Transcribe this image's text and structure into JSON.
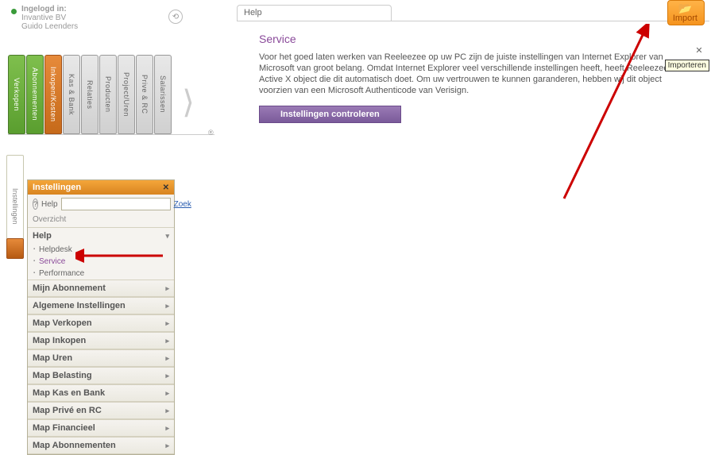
{
  "header": {
    "login_label": "Ingelogd in:",
    "company": "Invantive BV",
    "user": "Guido  Leenders"
  },
  "binders": [
    {
      "label": "Verkopen",
      "color": "green"
    },
    {
      "label": "Abonnementen",
      "color": "green"
    },
    {
      "label": "Inkopen/Kosten",
      "color": "orange"
    },
    {
      "label": "Kas & Bank",
      "color": "gray"
    },
    {
      "label": "Relaties",
      "color": "gray"
    },
    {
      "label": "Producten",
      "color": "gray"
    },
    {
      "label": "Project/Uren",
      "color": "gray"
    },
    {
      "label": "Prive & RC",
      "color": "gray"
    },
    {
      "label": "Salarissen",
      "color": "gray"
    }
  ],
  "settings_tab_label": "Instellingen",
  "panel": {
    "title": "Instellingen",
    "help_label": "Help",
    "search_placeholder": "",
    "zoek": "Zoek",
    "overzicht": "Overzicht",
    "help_group": "Help",
    "help_items": [
      "Helpdesk",
      "Service",
      "Performance"
    ],
    "groups": [
      "Mijn Abonnement",
      "Algemene Instellingen",
      "Map Verkopen",
      "Map Inkopen",
      "Map Uren",
      "Map Belasting",
      "Map Kas en Bank",
      "Map Privé en RC",
      "Map Financieel",
      "Map Abonnementen"
    ]
  },
  "main": {
    "breadcrumb": "Help",
    "import_label": "Import",
    "import_tooltip": "Importeren",
    "title": "Service",
    "body": "Voor het goed laten werken van Reeleezee op uw PC zijn de juiste instellingen van Internet Explorer van Microsoft van groot belang. Omdat Internet Explorer veel verschillende instellingen heeft, heeft Reeleezee een Active X object die dit automatisch doet. Om uw vertrouwen te kunnen garanderen, hebben wij dit object voorzien van een Microsoft Authenticode van Verisign.",
    "check_btn": "Instellingen controleren"
  }
}
